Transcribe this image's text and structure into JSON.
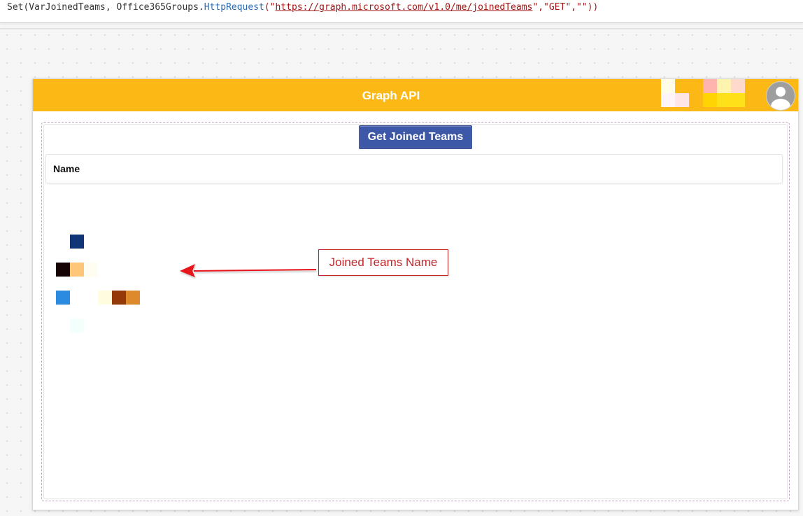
{
  "formula": {
    "prefix": "Set(VarJoinedTeams, Office365Groups.",
    "function": "HttpRequest",
    "open": "(\"",
    "url": "https://graph.microsoft.com/v1.0/me/joinedTeams",
    "rest": "\",\"GET\",\"\"))"
  },
  "header": {
    "title": "Graph API",
    "logo_colors": [
      "#fffde7",
      "#fff5f8",
      "#ffe5e5",
      "#ffb5ad",
      "#fff3b0",
      "#ffd9cc",
      "#ffd400",
      "#ffe11a"
    ]
  },
  "main": {
    "button_label": "Get Joined Teams",
    "column_header": "Name",
    "callout_text": "Joined Teams Name",
    "rows": [
      {
        "colors": [
          null,
          "#0f3576"
        ]
      },
      {
        "colors": [
          "#160303",
          "#ffc679",
          "#fffdf2"
        ]
      },
      {
        "colors": [
          "#2b8bde",
          null,
          null,
          "#fffce0",
          "#943908",
          "#dd8a2d"
        ]
      },
      {
        "colors": [
          null,
          "#f2fffd"
        ]
      }
    ]
  },
  "colors": {
    "header": "#fcb916",
    "button": "#3e58a8",
    "callout": "#c0282a"
  }
}
